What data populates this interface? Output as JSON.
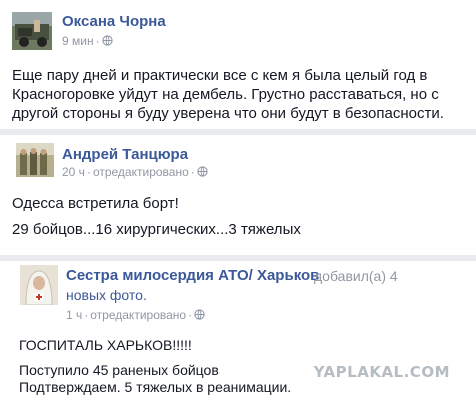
{
  "posts": [
    {
      "author": "Оксана Чорна",
      "time": "9 мин",
      "text": "Еще пару дней и практически все с кем я была целый год в Красногоровке уйдут на дембель. Грустно расставаться, но с другой стороны я буду уверена что они будут в безопасности."
    },
    {
      "author": "Андрей Танцюра",
      "time": "20 ч",
      "edited": "отредактировано",
      "lines": [
        "Одесса встретила борт!",
        "29 бойцов...16 хирургических...3 тяжелых"
      ]
    },
    {
      "author": "Сестра милосердия АТО/ Харьков",
      "added_text": "добавил(а) 4",
      "added_link": "новых фото.",
      "time": "1 ч",
      "edited": "отредактировано",
      "lines": [
        "ГОСПИТАЛЬ ХАРЬКОВ!!!!!",
        "Поступило 45 раненых бойцов",
        "Подтверждаем. 5 тяжелых в реанимации."
      ]
    }
  ],
  "watermark": "YAPLAKAL.COM",
  "colors": {
    "link": "#3b5998",
    "meta": "#9197a3",
    "separator": "#e9ebee"
  },
  "icons": [
    "globe-icon"
  ]
}
